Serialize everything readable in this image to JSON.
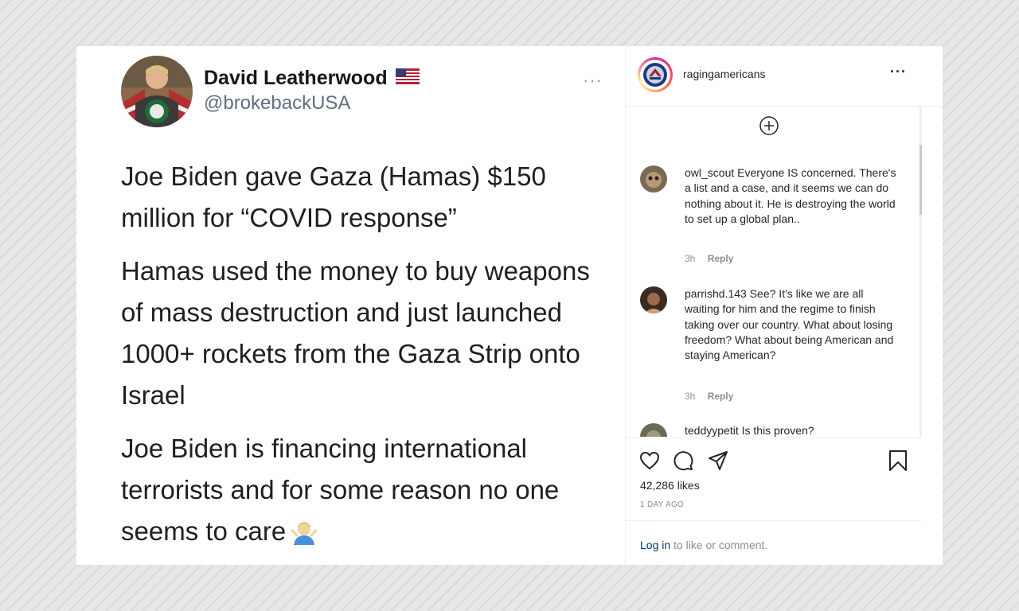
{
  "tweet": {
    "display_name": "David Leatherwood",
    "handle": "@brokebackUSA",
    "more_label": "···",
    "paragraphs": [
      "Joe Biden gave Gaza (Hamas) $150 million for “COVID response”",
      "Hamas used the money to buy weapons of mass destruction and just launched 1000+ rockets from the Gaza Strip onto Israel",
      "Joe Biden is financing international terrorists and for some reason no one seems to care"
    ],
    "flag_icon": "us-flag-icon",
    "emoji_icon": "person-shrugging-icon"
  },
  "instagram": {
    "username": "ragingamericans",
    "more_label": "···",
    "comments": [
      {
        "user": "owl_scout",
        "text": "Everyone IS concerned. There's a list and a case, and it seems we can do nothing about it. He is destroying the world to set up a global plan..",
        "age": "3h",
        "reply_label": "Reply"
      },
      {
        "user": "parrishd.143",
        "text": "See? It's like we are all waiting for him and the regime to finish taking over our country. What about losing freedom? What about being American and staying American?",
        "age": "3h",
        "reply_label": "Reply"
      },
      {
        "user": "teddyypetit",
        "text": "Is this proven?",
        "age": "",
        "reply_label": ""
      }
    ],
    "likes": "42,286 likes",
    "post_age": "1 DAY AGO",
    "login_link": "Log in",
    "login_suffix": "to like or comment.",
    "icons": [
      "plus-circle-icon",
      "heart-icon",
      "comment-icon",
      "share-icon",
      "bookmark-icon"
    ]
  }
}
